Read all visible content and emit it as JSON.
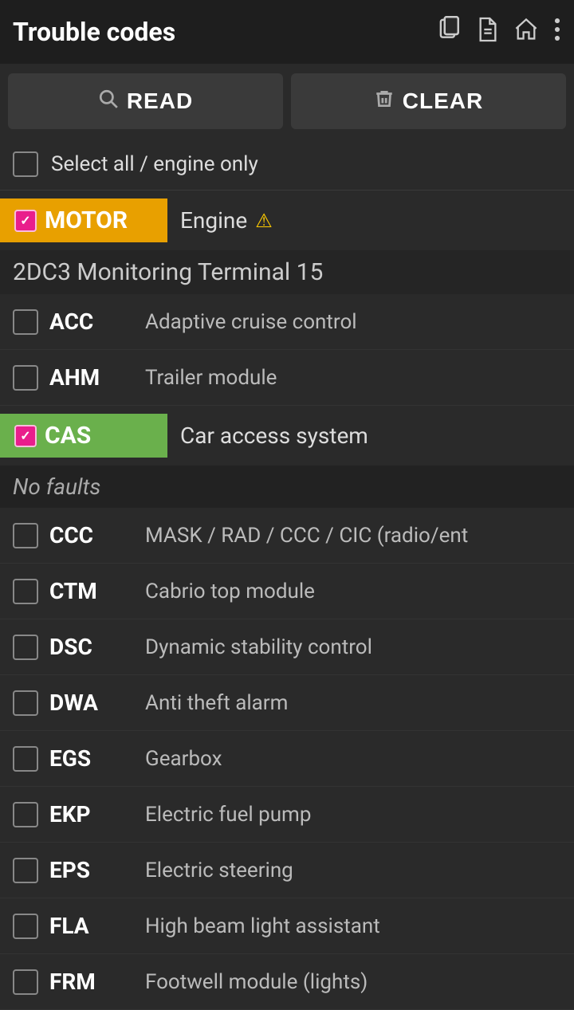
{
  "header": {
    "title": "Trouble codes",
    "icons": [
      "copy",
      "file",
      "home",
      "more-vertical"
    ]
  },
  "actions": {
    "read_label": "READ",
    "clear_label": "CLEAR"
  },
  "select_all": {
    "label": "Select all / engine only",
    "checked": false
  },
  "motor_module": {
    "tag": "MOTOR",
    "description": "Engine",
    "checked": true,
    "has_warning": true
  },
  "section_title": "2DC3 Monitoring Terminal 15",
  "systems": [
    {
      "code": "ACC",
      "name": "Adaptive cruise control",
      "checked": false
    },
    {
      "code": "AHM",
      "name": "Trailer module",
      "checked": false
    },
    {
      "code": "CAS",
      "name": "Car access system",
      "checked": true,
      "no_faults": true
    },
    {
      "code": "CCC",
      "name": "MASK / RAD / CCC / CIC (radio/ent",
      "checked": false
    },
    {
      "code": "CTM",
      "name": "Cabrio top module",
      "checked": false
    },
    {
      "code": "DSC",
      "name": "Dynamic stability control",
      "checked": false
    },
    {
      "code": "DWA",
      "name": "Anti theft alarm",
      "checked": false
    },
    {
      "code": "EGS",
      "name": "Gearbox",
      "checked": false
    },
    {
      "code": "EKP",
      "name": "Electric fuel pump",
      "checked": false
    },
    {
      "code": "EPS",
      "name": "Electric steering",
      "checked": false
    },
    {
      "code": "FLA",
      "name": "High beam light assistant",
      "checked": false
    },
    {
      "code": "FRM",
      "name": "Footwell module (lights)",
      "checked": false
    }
  ],
  "no_faults_label": "No faults",
  "colors": {
    "accent_orange": "#e8a000",
    "accent_green": "#6ab04c",
    "accent_pink": "#e91e8c",
    "bg_dark": "#1e1e1e",
    "bg_main": "#2a2a2a"
  }
}
